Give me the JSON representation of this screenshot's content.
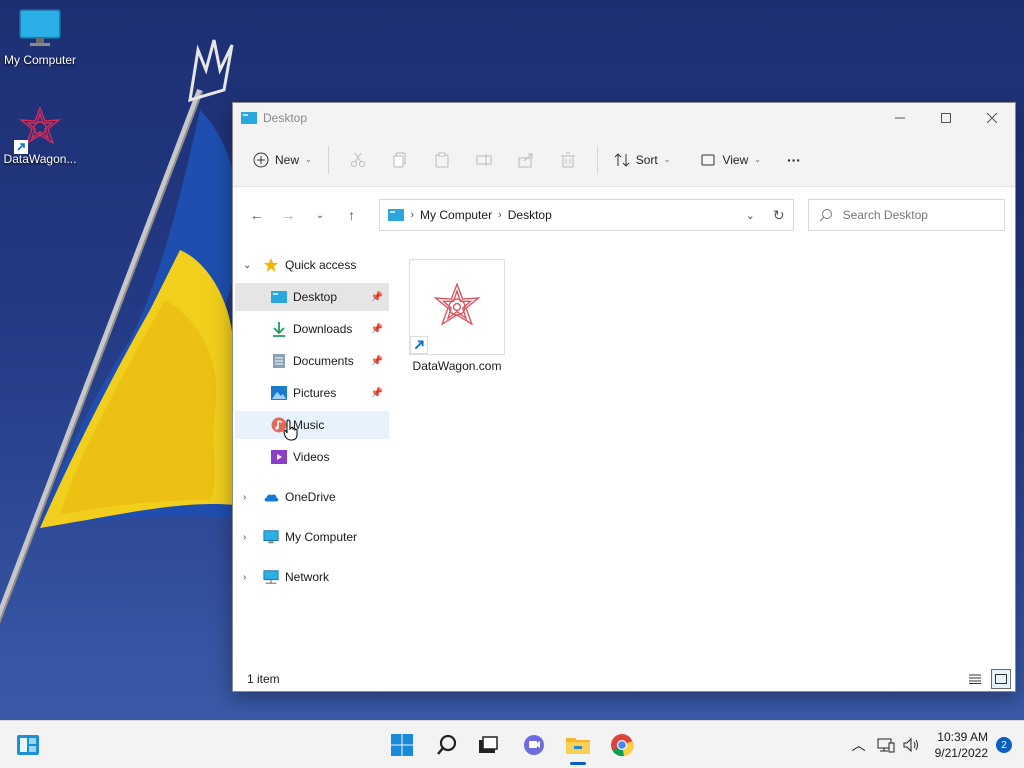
{
  "desktop": {
    "icons": [
      {
        "label": "My Computer"
      },
      {
        "label": "DataWagon..."
      }
    ]
  },
  "window": {
    "title": "Desktop",
    "toolbar": {
      "new_label": "New",
      "sort_label": "Sort",
      "view_label": "View",
      "more_label": "···"
    },
    "address": {
      "crumbs": [
        "My Computer",
        "Desktop"
      ]
    },
    "search": {
      "placeholder": "Search Desktop"
    },
    "sidebar": {
      "quick_access": "Quick access",
      "items": [
        {
          "label": "Desktop",
          "icon": "desktop-icon",
          "pinned": true
        },
        {
          "label": "Downloads",
          "icon": "download-icon",
          "pinned": true
        },
        {
          "label": "Documents",
          "icon": "document-icon",
          "pinned": true
        },
        {
          "label": "Pictures",
          "icon": "pictures-icon",
          "pinned": true
        },
        {
          "label": "Music",
          "icon": "music-icon",
          "pinned": false
        },
        {
          "label": "Videos",
          "icon": "videos-icon",
          "pinned": false
        }
      ],
      "roots": [
        {
          "label": "OneDrive",
          "icon": "onedrive-icon"
        },
        {
          "label": "My Computer",
          "icon": "computer-icon"
        },
        {
          "label": "Network",
          "icon": "network-icon"
        }
      ]
    },
    "files": [
      {
        "name": "DataWagon.com"
      }
    ],
    "status": {
      "item_count": "1 item"
    }
  },
  "taskbar": {
    "time": "10:39 AM",
    "date": "9/21/2022",
    "notifications": "2"
  },
  "colors": {
    "accent": "#0a5fc4",
    "flag_blue": "#1e4fb0",
    "flag_yellow": "#f2cf1d"
  }
}
